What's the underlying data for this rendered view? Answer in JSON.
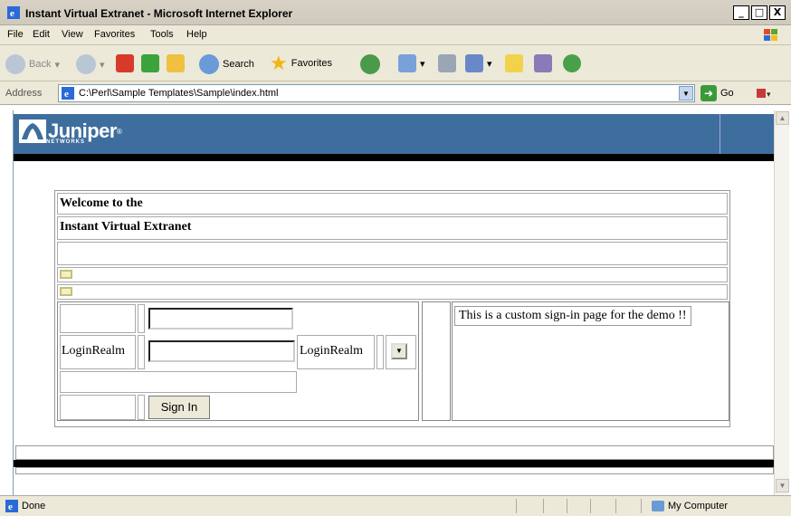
{
  "window": {
    "title": "Instant Virtual Extranet - Microsoft Internet Explorer",
    "min": "_",
    "max": "□",
    "close": "X"
  },
  "menu": [
    "File",
    "Edit",
    "View",
    "Favorites",
    "Tools",
    "Help"
  ],
  "toolbar": {
    "back": "Back",
    "search": "Search",
    "favorites": "Favorites"
  },
  "address": {
    "label": "Address",
    "url": "C:\\Perl\\Sample Templates\\Sample\\index.html",
    "go": "Go"
  },
  "page": {
    "logo": "Juniper",
    "logo_sub": "NETWORKS",
    "welcome_line1": "Welcome to the",
    "welcome_line2": "Instant Virtual Extranet",
    "realm_label_1": "LoginRealm",
    "realm_label_2": "LoginRealm",
    "signin": "Sign In",
    "custom_message": "This is a custom sign-in page for the demo !!"
  },
  "status": {
    "text": "Done",
    "zone": "My Computer"
  },
  "colors": {
    "banner": "#3e6e9e",
    "chrome": "#ece9d8"
  }
}
